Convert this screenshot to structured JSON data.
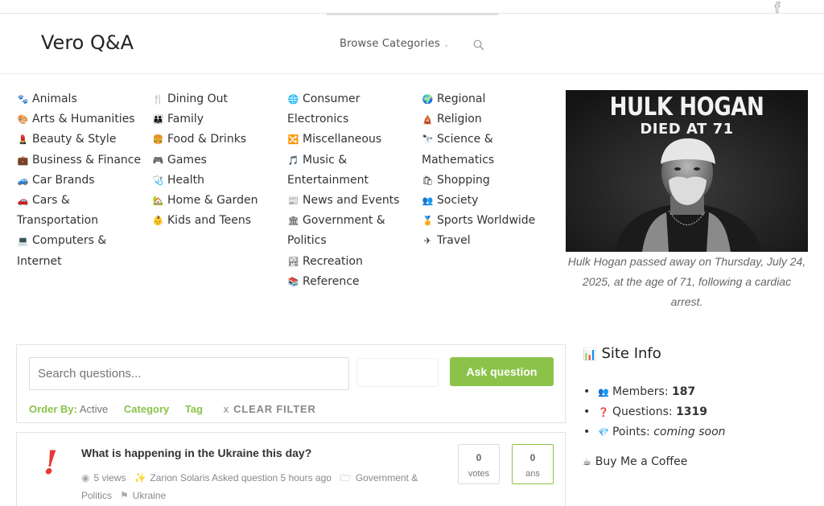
{
  "site": {
    "logo": "Vero Q&A",
    "browse_label": "Browse Categories",
    "browse_chevron": "⌵"
  },
  "categories": {
    "col1": [
      {
        "icon": "paw-icon",
        "glyph": "🐾",
        "label": "Animals"
      },
      {
        "icon": "palette-icon",
        "glyph": "🎨",
        "label": "Arts & Humanities"
      },
      {
        "icon": "lipstick-icon",
        "glyph": "💄",
        "label": "Beauty & Style"
      },
      {
        "icon": "briefcase-icon",
        "glyph": "💼",
        "label": "Business & Finance"
      },
      {
        "icon": "car-icon",
        "glyph": "🚙",
        "label": "Car Brands"
      },
      {
        "icon": "red-car-icon",
        "glyph": "🚗",
        "label": "Cars & Transportation"
      },
      {
        "icon": "laptop-icon",
        "glyph": "💻",
        "label": "Computers & Internet"
      }
    ],
    "col2": [
      {
        "icon": "fork-knife-icon",
        "glyph": "🍴",
        "label": "Dining Out"
      },
      {
        "icon": "family-icon",
        "glyph": "👪",
        "label": "Family"
      },
      {
        "icon": "burger-icon",
        "glyph": "🍔",
        "label": "Food & Drinks"
      },
      {
        "icon": "gamepad-icon",
        "glyph": "🎮",
        "label": "Games"
      },
      {
        "icon": "stethoscope-icon",
        "glyph": "🩺",
        "label": "Health"
      },
      {
        "icon": "house-garden-icon",
        "glyph": "🏡",
        "label": "Home & Garden"
      },
      {
        "icon": "baby-icon",
        "glyph": "👶",
        "label": "Kids and Teens"
      }
    ],
    "col3": [
      {
        "icon": "globe-icon",
        "glyph": "🌐",
        "label": "Consumer Electronics"
      },
      {
        "icon": "shuffle-icon",
        "glyph": "🔀",
        "label": "Miscellaneous"
      },
      {
        "icon": "music-note-icon",
        "glyph": "🎵",
        "label": "Music & Entertainment"
      },
      {
        "icon": "newspaper-icon",
        "glyph": "📰",
        "label": "News and Events"
      },
      {
        "icon": "government-icon",
        "glyph": "🏛",
        "label": "Government & Politics"
      },
      {
        "icon": "landscape-icon",
        "glyph": "🏞",
        "label": "Recreation"
      },
      {
        "icon": "books-icon",
        "glyph": "📚",
        "label": "Reference"
      }
    ],
    "col4": [
      {
        "icon": "earth-icon",
        "glyph": "🌍",
        "label": "Regional"
      },
      {
        "icon": "temple-icon",
        "glyph": "🛕",
        "label": "Religion"
      },
      {
        "icon": "telescope-icon",
        "glyph": "🔭",
        "label": "Science & Mathematics"
      },
      {
        "icon": "shopping-bags-icon",
        "glyph": "🛍",
        "label": "Shopping"
      },
      {
        "icon": "people-icon",
        "glyph": "👥",
        "label": "Society"
      },
      {
        "icon": "medal-icon",
        "glyph": "🏅",
        "label": "Sports Worldwide"
      },
      {
        "icon": "airplane-icon",
        "glyph": "✈",
        "label": "Travel"
      }
    ]
  },
  "feature": {
    "headline": "HULK HOGAN",
    "subheadline": "DIED AT 71",
    "caption": "Hulk Hogan passed away on Thursday, July 24, 2025, at the age of 71, following a cardiac arrest."
  },
  "search": {
    "placeholder": "Search questions...",
    "ask_label": "Ask question"
  },
  "filters": {
    "order_label": "Order By:",
    "order_value": "Active",
    "category_label": "Category",
    "tag_label": "Tag",
    "clear_x": "x",
    "clear_label": "CLEAR FILTER"
  },
  "question": {
    "mark": "!",
    "title": "What is happening in the Ukraine this day?",
    "views": "5 views",
    "author_action": "Zarion Solaris Asked question 5 hours ago",
    "category": "Government & Politics",
    "tag": "Ukraine",
    "votes": "0",
    "votes_label": "votes",
    "answers": "0",
    "answers_label": "ans"
  },
  "site_info": {
    "title": "Site Info",
    "members_label": "Members:",
    "members_value": "187",
    "questions_label": "Questions:",
    "questions_value": "1319",
    "points_label": "Points:",
    "points_value": "coming soon"
  },
  "coffee_label": "Buy Me a Coffee",
  "colors": {
    "accent_green": "#8bc34a",
    "question_mark_red": "#e53935"
  }
}
